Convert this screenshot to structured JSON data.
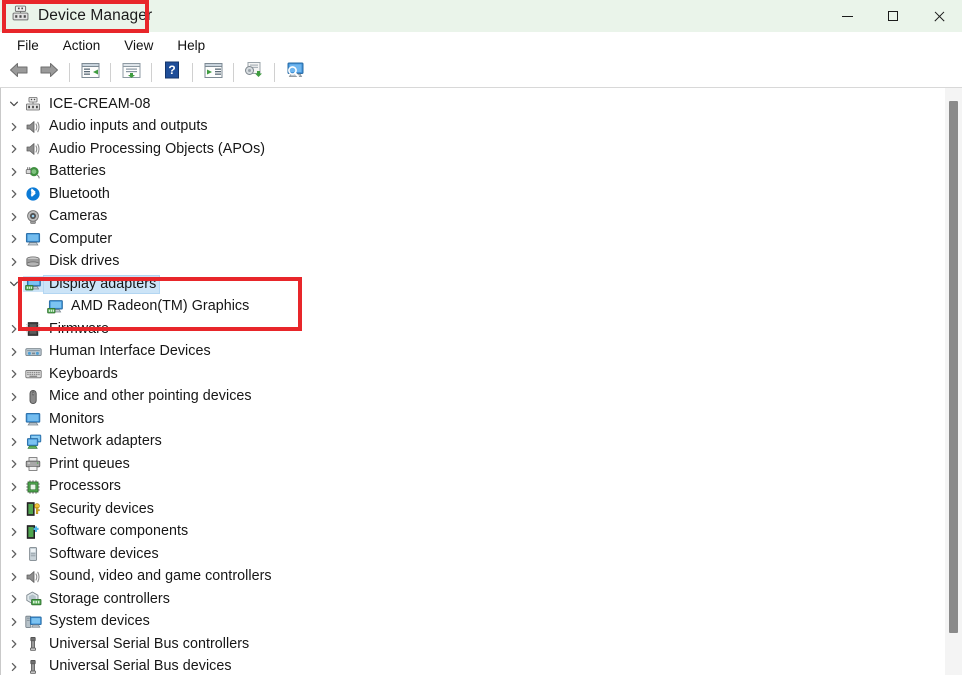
{
  "window": {
    "title": "Device Manager",
    "title_icon": "device-manager-icon",
    "controls": {
      "minimize": "minimize-icon",
      "maximize": "maximize-icon",
      "close": "close-icon"
    }
  },
  "menubar": {
    "items": [
      {
        "label": "File"
      },
      {
        "label": "Action"
      },
      {
        "label": "View"
      },
      {
        "label": "Help"
      }
    ]
  },
  "toolbar": {
    "buttons": [
      {
        "name": "back-icon",
        "tip": "Back"
      },
      {
        "name": "forward-icon",
        "tip": "Forward"
      },
      {
        "name": "properties-icon",
        "tip": "Properties"
      },
      {
        "name": "update-driver-icon",
        "tip": "Update driver"
      },
      {
        "name": "help-icon",
        "tip": "Help"
      },
      {
        "name": "scan-hardware-icon",
        "tip": "Scan for hardware changes"
      },
      {
        "name": "uninstall-device-icon",
        "tip": "Uninstall device"
      },
      {
        "name": "show-hidden-icon",
        "tip": "Show hidden devices"
      }
    ]
  },
  "tree": {
    "root": {
      "label": "ICE-CREAM-08",
      "icon": "computer-root-icon",
      "expanded": true
    },
    "nodes": [
      {
        "label": "Audio inputs and outputs",
        "icon": "speaker-icon",
        "expanded": false,
        "selected": false,
        "indent": 1
      },
      {
        "label": "Audio Processing Objects (APOs)",
        "icon": "speaker-icon",
        "expanded": false,
        "selected": false,
        "indent": 1
      },
      {
        "label": "Batteries",
        "icon": "battery-icon",
        "expanded": false,
        "selected": false,
        "indent": 1
      },
      {
        "label": "Bluetooth",
        "icon": "bluetooth-icon",
        "expanded": false,
        "selected": false,
        "indent": 1
      },
      {
        "label": "Cameras",
        "icon": "camera-icon",
        "expanded": false,
        "selected": false,
        "indent": 1
      },
      {
        "label": "Computer",
        "icon": "computer-icon",
        "expanded": false,
        "selected": false,
        "indent": 1
      },
      {
        "label": "Disk drives",
        "icon": "disk-drive-icon",
        "expanded": false,
        "selected": false,
        "indent": 1
      },
      {
        "label": "Display adapters",
        "icon": "display-adapter-icon",
        "expanded": true,
        "selected": true,
        "indent": 1
      },
      {
        "label": "AMD Radeon(TM) Graphics",
        "icon": "display-adapter-icon",
        "expanded": null,
        "selected": false,
        "indent": 2
      },
      {
        "label": "Firmware",
        "icon": "firmware-icon",
        "expanded": false,
        "selected": false,
        "indent": 1
      },
      {
        "label": "Human Interface Devices",
        "icon": "hid-icon",
        "expanded": false,
        "selected": false,
        "indent": 1
      },
      {
        "label": "Keyboards",
        "icon": "keyboard-icon",
        "expanded": false,
        "selected": false,
        "indent": 1
      },
      {
        "label": "Mice and other pointing devices",
        "icon": "mouse-icon",
        "expanded": false,
        "selected": false,
        "indent": 1
      },
      {
        "label": "Monitors",
        "icon": "monitor-icon",
        "expanded": false,
        "selected": false,
        "indent": 1
      },
      {
        "label": "Network adapters",
        "icon": "network-adapter-icon",
        "expanded": false,
        "selected": false,
        "indent": 1
      },
      {
        "label": "Print queues",
        "icon": "printer-icon",
        "expanded": false,
        "selected": false,
        "indent": 1
      },
      {
        "label": "Processors",
        "icon": "processor-icon",
        "expanded": false,
        "selected": false,
        "indent": 1
      },
      {
        "label": "Security devices",
        "icon": "security-device-icon",
        "expanded": false,
        "selected": false,
        "indent": 1
      },
      {
        "label": "Software components",
        "icon": "software-component-icon",
        "expanded": false,
        "selected": false,
        "indent": 1
      },
      {
        "label": "Software devices",
        "icon": "software-device-icon",
        "expanded": false,
        "selected": false,
        "indent": 1
      },
      {
        "label": "Sound, video and game controllers",
        "icon": "speaker-icon",
        "expanded": false,
        "selected": false,
        "indent": 1
      },
      {
        "label": "Storage controllers",
        "icon": "storage-controller-icon",
        "expanded": false,
        "selected": false,
        "indent": 1
      },
      {
        "label": "System devices",
        "icon": "system-device-icon",
        "expanded": false,
        "selected": false,
        "indent": 1
      },
      {
        "label": "Universal Serial Bus controllers",
        "icon": "usb-icon",
        "expanded": false,
        "selected": false,
        "indent": 1
      },
      {
        "label": "Universal Serial Bus devices",
        "icon": "usb-icon",
        "expanded": false,
        "selected": false,
        "indent": 1
      }
    ]
  },
  "annotations": {
    "color": "#e8262a",
    "boxes": [
      {
        "name": "title-highlight",
        "target": "Device Manager"
      },
      {
        "name": "display-adapters-highlight",
        "target": "Display adapters"
      }
    ]
  },
  "scrollbar": {
    "orientation": "vertical",
    "position": "near-top"
  }
}
